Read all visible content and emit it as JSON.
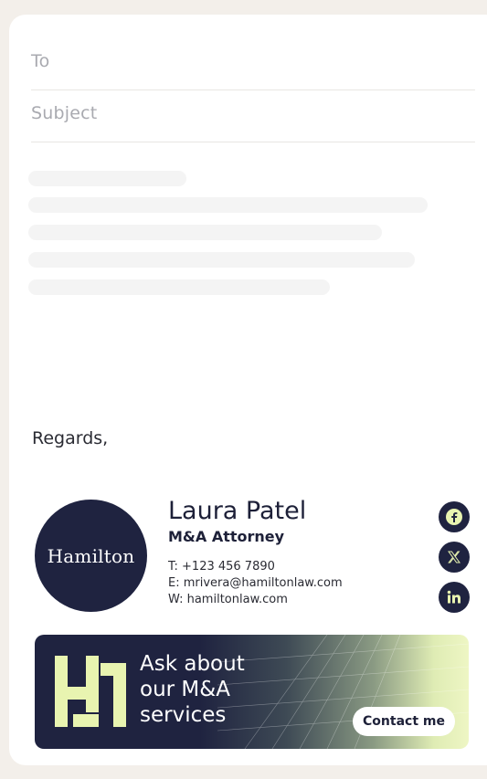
{
  "compose": {
    "to_placeholder": "To",
    "subject_placeholder": "Subject"
  },
  "body": {
    "closing": "Regards,"
  },
  "signature": {
    "logo_text": "Hamilton",
    "name": "Laura Patel",
    "title": "M&A Attorney",
    "phone": "T: +123 456 7890",
    "email": "E: mrivera@hamiltonlaw.com",
    "website": "W: hamiltonlaw.com",
    "socials": [
      "facebook-icon",
      "x-icon",
      "linkedin-icon"
    ]
  },
  "banner": {
    "headline_line1": "Ask about",
    "headline_line2": "our M&A",
    "headline_line3": "services",
    "cta_label": "Contact me"
  },
  "colors": {
    "page_bg": "#f3efea",
    "brand_navy": "#1f2340",
    "brand_lime": "#e8f4b0"
  }
}
